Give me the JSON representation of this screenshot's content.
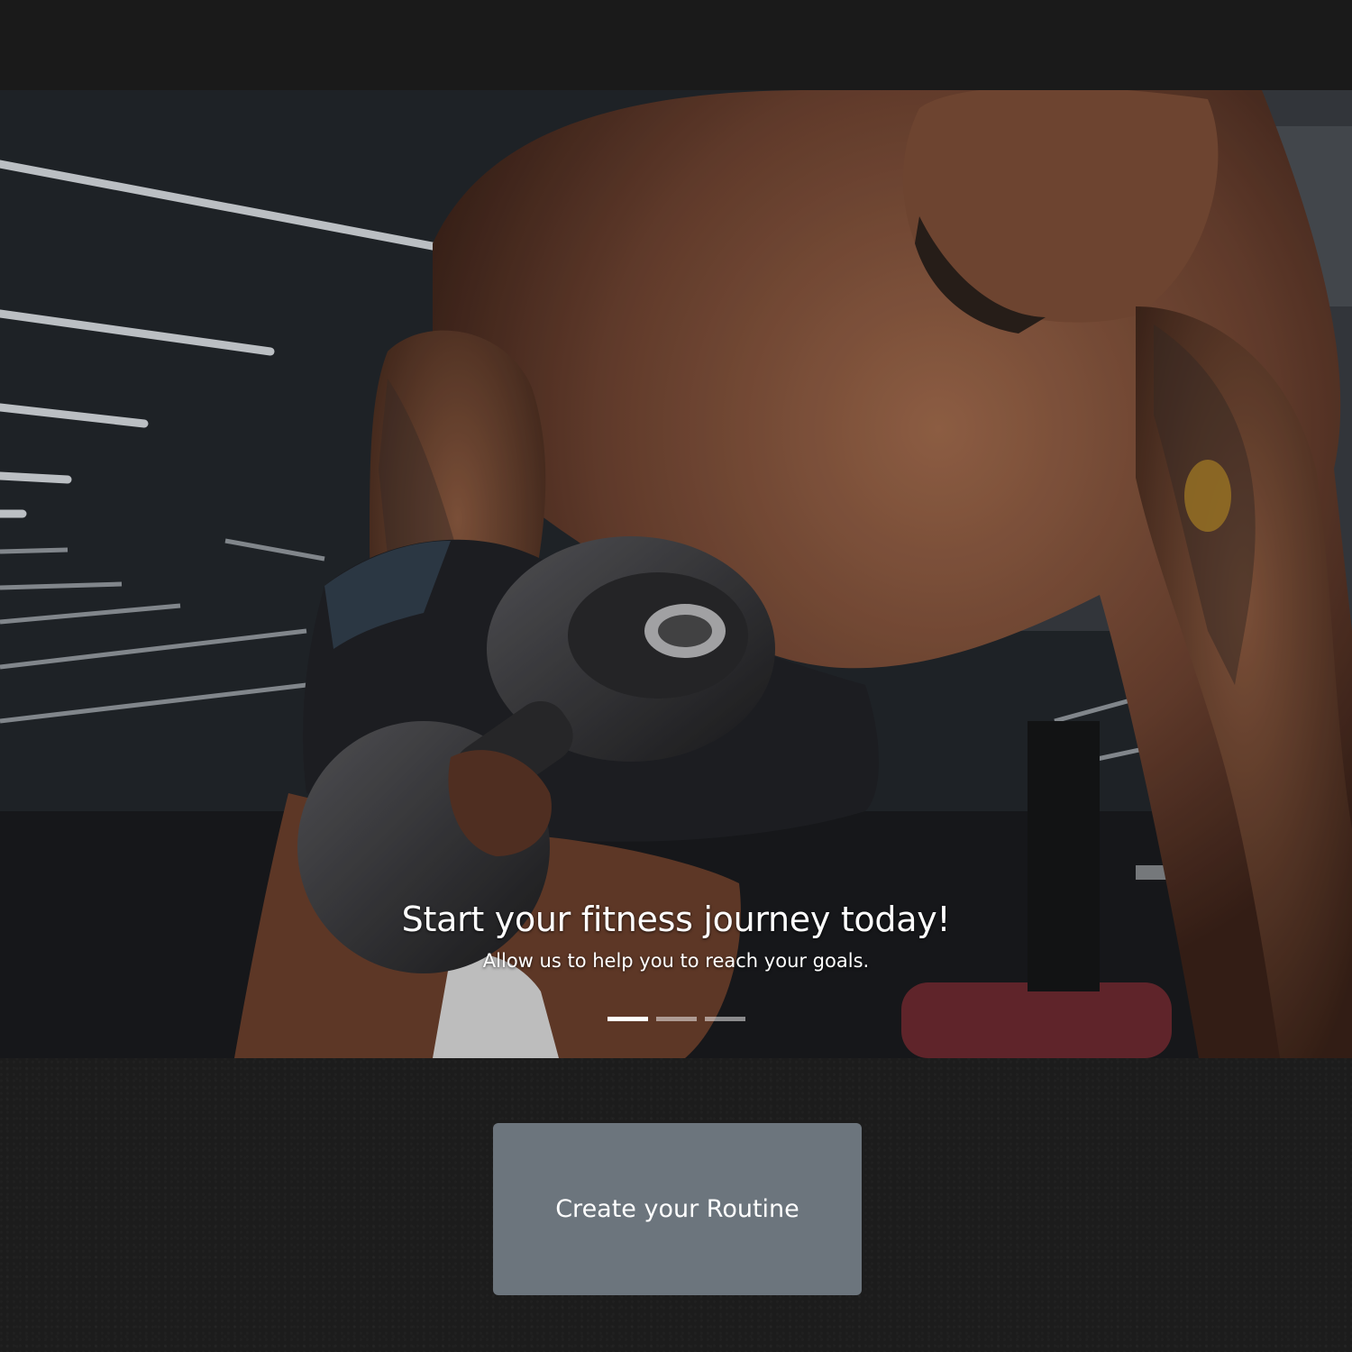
{
  "carousel": {
    "slide_image": "athlete-dumbbell-row-photo",
    "caption_title": "Start your fitness journey today!",
    "caption_subtitle": "Allow us to help you to reach your goals.",
    "indicators": [
      {
        "active": true
      },
      {
        "active": false
      },
      {
        "active": false
      }
    ]
  },
  "cta": {
    "label": "Create your Routine",
    "color": "#6c757d"
  }
}
